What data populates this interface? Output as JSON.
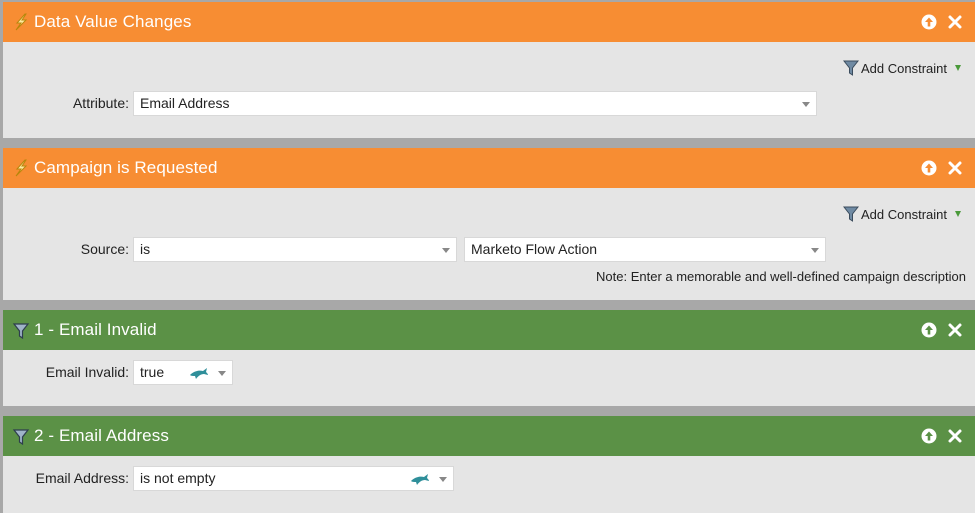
{
  "blocks": [
    {
      "title": "Data Value Changes",
      "add_constraint": "Add Constraint",
      "attribute_label": "Attribute:",
      "attribute_value": "Email Address"
    },
    {
      "title": "Campaign is Requested",
      "add_constraint": "Add Constraint",
      "source_label": "Source:",
      "source_operator": "is",
      "source_value": "Marketo Flow Action",
      "note": "Note: Enter a memorable and well-defined campaign description"
    },
    {
      "title": "1 - Email Invalid",
      "field_label": "Email Invalid:",
      "field_value": "true"
    },
    {
      "title": "2 - Email Address",
      "field_label": "Email Address:",
      "field_value": "is not empty"
    }
  ],
  "colors": {
    "trigger_header": "#f78d33",
    "filter_header": "#5b9146",
    "panel_body": "#e5e5e5"
  },
  "icons": {
    "trigger": "lightning-bolt-icon",
    "filter": "funnel-icon",
    "move_up": "arrow-up-circle-icon",
    "remove": "close-icon",
    "dynamic_value": "dolphin-icon"
  }
}
